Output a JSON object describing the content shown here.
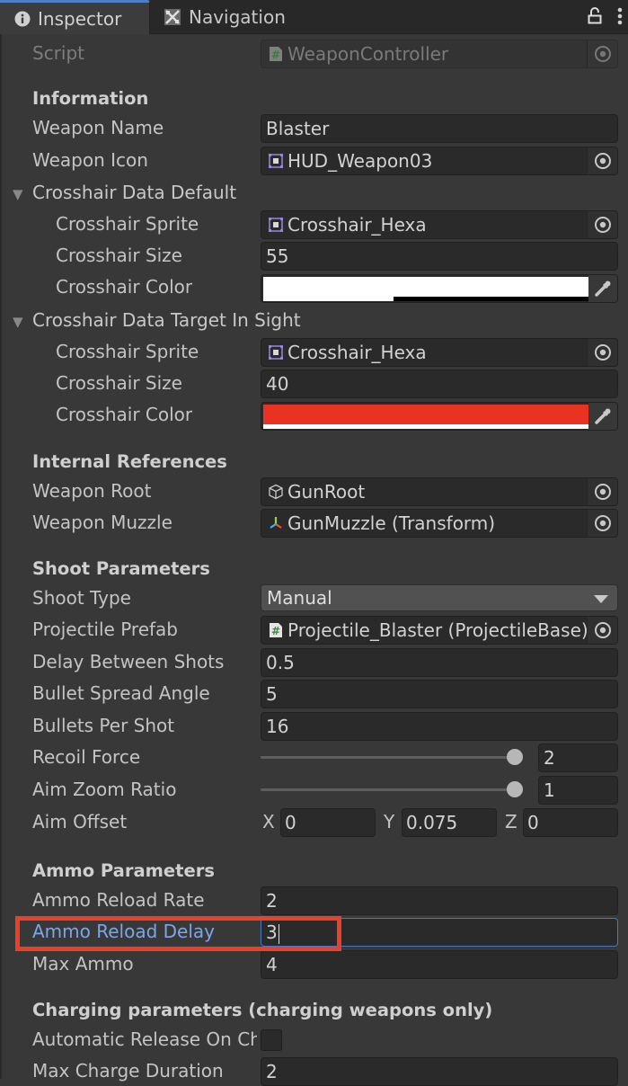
{
  "tabs": [
    {
      "label": "Inspector",
      "icon": "info-icon",
      "active": true
    },
    {
      "label": "Navigation",
      "icon": "navigation-icon",
      "active": false
    }
  ],
  "toolbar": {
    "lock_icon": "unlock-icon",
    "menu_icon": "kebab-menu-icon"
  },
  "script": {
    "label": "Script",
    "value": "WeaponController",
    "icon": "csharp-script-icon"
  },
  "information": {
    "header": "Information",
    "weapon_name": {
      "label": "Weapon Name",
      "value": "Blaster"
    },
    "weapon_icon": {
      "label": "Weapon Icon",
      "value": "HUD_Weapon03",
      "icon": "sprite-icon"
    }
  },
  "crosshair_default": {
    "label": "Crosshair Data Default",
    "expanded": true,
    "sprite": {
      "label": "Crosshair Sprite",
      "value": "Crosshair_Hexa"
    },
    "size": {
      "label": "Crosshair Size",
      "value": "55"
    },
    "color": {
      "label": "Crosshair Color",
      "value": "#ffffff",
      "alpha_fraction": 0.4
    }
  },
  "crosshair_target": {
    "label": "Crosshair Data Target In Sight",
    "expanded": true,
    "sprite": {
      "label": "Crosshair Sprite",
      "value": "Crosshair_Hexa"
    },
    "size": {
      "label": "Crosshair Size",
      "value": "40"
    },
    "color": {
      "label": "Crosshair Color",
      "value": "#e83323",
      "alpha_fraction": 1.0
    }
  },
  "internal_references": {
    "header": "Internal References",
    "weapon_root": {
      "label": "Weapon Root",
      "value": "GunRoot",
      "icon": "gameobject-cube-icon"
    },
    "weapon_muzzle": {
      "label": "Weapon Muzzle",
      "value": "GunMuzzle (Transform)",
      "icon": "transform-icon"
    }
  },
  "shoot_parameters": {
    "header": "Shoot Parameters",
    "shoot_type": {
      "label": "Shoot Type",
      "value": "Manual"
    },
    "projectile_prefab": {
      "label": "Projectile Prefab",
      "value": "Projectile_Blaster (ProjectileBase)",
      "icon": "csharp-script-icon"
    },
    "delay_between_shots": {
      "label": "Delay Between Shots",
      "value": "0.5"
    },
    "bullet_spread_angle": {
      "label": "Bullet Spread Angle",
      "value": "5"
    },
    "bullets_per_shot": {
      "label": "Bullets Per Shot",
      "value": "16"
    },
    "recoil_force": {
      "label": "Recoil Force",
      "value": "2",
      "slider_fraction": 1.0
    },
    "aim_zoom_ratio": {
      "label": "Aim Zoom Ratio",
      "value": "1",
      "slider_fraction": 1.0
    },
    "aim_offset": {
      "label": "Aim Offset",
      "x_label": "X",
      "x": "0",
      "y_label": "Y",
      "y": "0.075",
      "z_label": "Z",
      "z": "0"
    }
  },
  "ammo_parameters": {
    "header": "Ammo Parameters",
    "ammo_reload_rate": {
      "label": "Ammo Reload Rate",
      "value": "2"
    },
    "ammo_reload_delay": {
      "label": "Ammo Reload Delay",
      "value": "3",
      "focused": true
    },
    "max_ammo": {
      "label": "Max Ammo",
      "value": "4"
    }
  },
  "charging_parameters": {
    "header": "Charging parameters (charging weapons only)",
    "automatic_release": {
      "label": "Automatic Release On Ch",
      "checked": false
    },
    "max_charge_duration": {
      "label": "Max Charge Duration",
      "value": "2"
    }
  },
  "annotation": {
    "highlight_color": "#e8402a",
    "target": "Ammo Reload Delay"
  }
}
